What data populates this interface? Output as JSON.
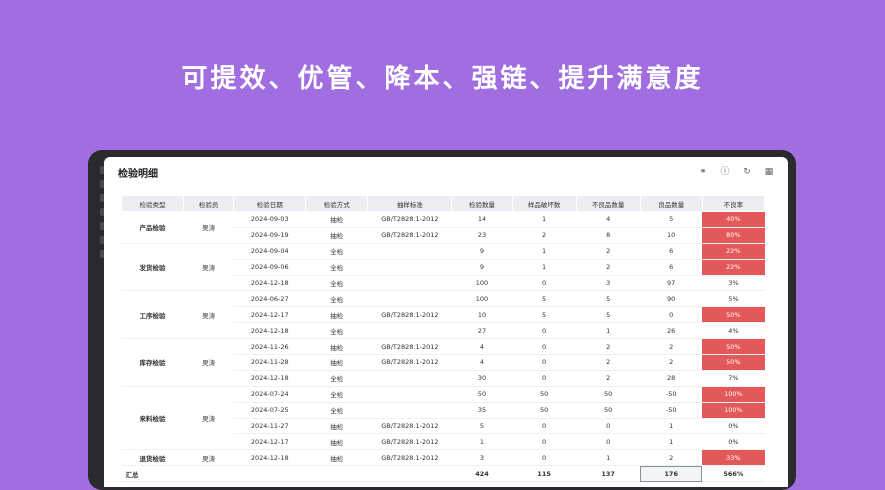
{
  "headline": "可提效、优管、降本、强链、提升满意度",
  "panel": {
    "title": "检验明细"
  },
  "columns": [
    "检验类型",
    "检验员",
    "检验日期",
    "检验方式",
    "抽样标准",
    "检验数量",
    "样品破坏数",
    "不良品数量",
    "良品数量",
    "不良率"
  ],
  "rows": [
    {
      "type": "产品检验",
      "inspector": "吴涛",
      "date": "2024-09-03",
      "method": "抽检",
      "standard": "GB/T2828.1-2012",
      "qty": "14",
      "destroyed": "1",
      "defects": "4",
      "good": "5",
      "rate": "40%",
      "bad": true
    },
    {
      "type": "",
      "inspector": "",
      "date": "2024-09-19",
      "method": "抽检",
      "standard": "GB/T2828.1-2012",
      "qty": "23",
      "destroyed": "2",
      "defects": "8",
      "good": "10",
      "rate": "80%",
      "bad": true
    },
    {
      "type": "发货检验",
      "inspector": "吴涛",
      "date": "2024-09-04",
      "method": "全检",
      "standard": "",
      "qty": "9",
      "destroyed": "1",
      "defects": "2",
      "good": "6",
      "rate": "22%",
      "bad": true
    },
    {
      "type": "",
      "inspector": "",
      "date": "2024-09-06",
      "method": "全检",
      "standard": "",
      "qty": "9",
      "destroyed": "1",
      "defects": "2",
      "good": "6",
      "rate": "22%",
      "bad": true
    },
    {
      "type": "",
      "inspector": "",
      "date": "2024-12-18",
      "method": "全检",
      "standard": "",
      "qty": "100",
      "destroyed": "0",
      "defects": "3",
      "good": "97",
      "rate": "3%",
      "bad": false
    },
    {
      "type": "工序检验",
      "inspector": "吴涛",
      "date": "2024-06-27",
      "method": "全检",
      "standard": "",
      "qty": "100",
      "destroyed": "5",
      "defects": "5",
      "good": "90",
      "rate": "5%",
      "bad": false
    },
    {
      "type": "",
      "inspector": "",
      "date": "2024-12-17",
      "method": "抽检",
      "standard": "GB/T2828.1-2012",
      "qty": "10",
      "destroyed": "5",
      "defects": "5",
      "good": "0",
      "rate": "50%",
      "bad": true
    },
    {
      "type": "",
      "inspector": "",
      "date": "2024-12-18",
      "method": "全检",
      "standard": "",
      "qty": "27",
      "destroyed": "0",
      "defects": "1",
      "good": "26",
      "rate": "4%",
      "bad": false
    },
    {
      "type": "库存检验",
      "inspector": "吴涛",
      "date": "2024-11-26",
      "method": "抽检",
      "standard": "GB/T2828.1-2012",
      "qty": "4",
      "destroyed": "0",
      "defects": "2",
      "good": "2",
      "rate": "50%",
      "bad": true
    },
    {
      "type": "",
      "inspector": "",
      "date": "2024-11-28",
      "method": "抽检",
      "standard": "GB/T2828.1-2012",
      "qty": "4",
      "destroyed": "0",
      "defects": "2",
      "good": "2",
      "rate": "50%",
      "bad": true
    },
    {
      "type": "",
      "inspector": "",
      "date": "2024-12-18",
      "method": "全检",
      "standard": "",
      "qty": "30",
      "destroyed": "0",
      "defects": "2",
      "good": "28",
      "rate": "7%",
      "bad": false
    },
    {
      "type": "来料检验",
      "inspector": "吴涛",
      "date": "2024-07-24",
      "method": "全检",
      "standard": "",
      "qty": "50",
      "destroyed": "50",
      "defects": "50",
      "good": "-50",
      "rate": "100%",
      "bad": true
    },
    {
      "type": "",
      "inspector": "",
      "date": "2024-07-25",
      "method": "全检",
      "standard": "",
      "qty": "35",
      "destroyed": "50",
      "defects": "50",
      "good": "-50",
      "rate": "100%",
      "bad": true
    },
    {
      "type": "",
      "inspector": "",
      "date": "2024-11-27",
      "method": "抽检",
      "standard": "GB/T2828.1-2012",
      "qty": "5",
      "destroyed": "0",
      "defects": "0",
      "good": "1",
      "rate": "0%",
      "bad": false
    },
    {
      "type": "",
      "inspector": "",
      "date": "2024-12-17",
      "method": "抽检",
      "standard": "GB/T2828.1-2012",
      "qty": "1",
      "destroyed": "0",
      "defects": "0",
      "good": "1",
      "rate": "0%",
      "bad": false
    },
    {
      "type": "退货检验",
      "inspector": "吴涛",
      "date": "2024-12-18",
      "method": "抽检",
      "standard": "GB/T2828.1-2012",
      "qty": "3",
      "destroyed": "0",
      "defects": "1",
      "good": "2",
      "rate": "33%",
      "bad": true
    }
  ],
  "groups": [
    {
      "start": 0,
      "span": 2
    },
    {
      "start": 2,
      "span": 3
    },
    {
      "start": 5,
      "span": 3
    },
    {
      "start": 8,
      "span": 3
    },
    {
      "start": 11,
      "span": 4
    },
    {
      "start": 15,
      "span": 1
    }
  ],
  "summary": {
    "label": "汇总",
    "qty": "424",
    "destroyed": "115",
    "defects": "137",
    "good": "176",
    "rate": "566%"
  },
  "colors": {
    "background": "#a06ee0",
    "bad_rate": "#e3595a"
  },
  "icons": [
    "share-icon",
    "info-icon",
    "refresh-icon",
    "grid-icon"
  ]
}
